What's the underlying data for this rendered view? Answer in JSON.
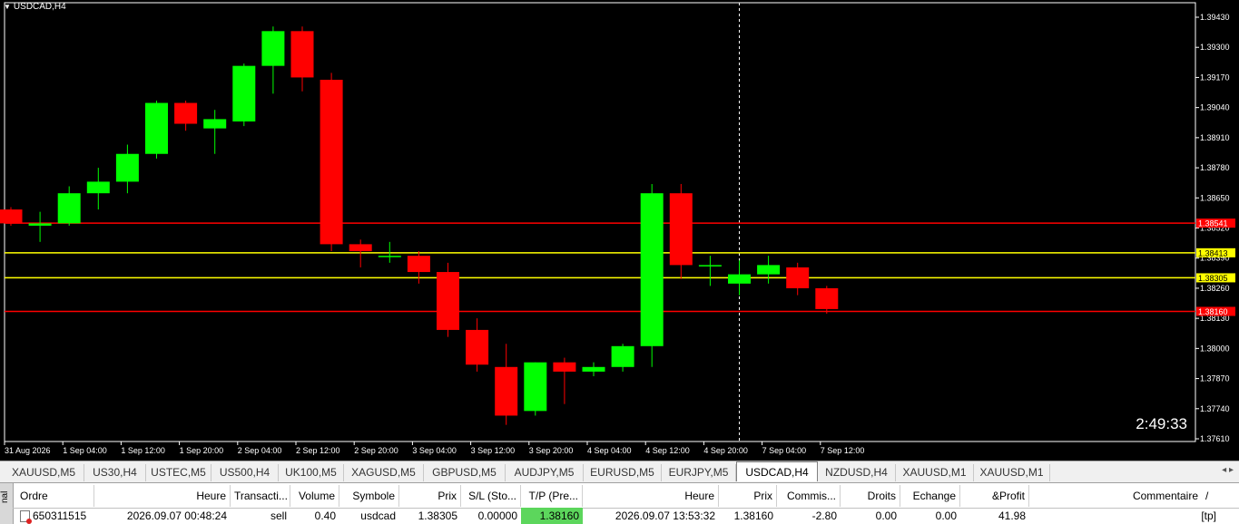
{
  "chart": {
    "symbol_label": "USDCAD,H4",
    "countdown": "2:49:33",
    "colors": {
      "bull": "#00ff00",
      "bear": "#ff0000",
      "background": "#000000",
      "axis": "#ffffff",
      "line_red": "#ff0000",
      "line_yellow": "#ffff00"
    },
    "y_range": [
      1.3761,
      1.3943
    ],
    "price_ticks": [
      "1.39430",
      "1.39300",
      "1.39170",
      "1.39040",
      "1.38910",
      "1.38780",
      "1.38650",
      "1.38520",
      "1.38390",
      "1.38260",
      "1.38130",
      "1.38000",
      "1.37870",
      "1.37740",
      "1.37610"
    ],
    "time_ticks": [
      "31 Aug 2026",
      "1 Sep 04:00",
      "1 Sep 12:00",
      "1 Sep 20:00",
      "2 Sep 04:00",
      "2 Sep 12:00",
      "2 Sep 20:00",
      "3 Sep 04:00",
      "3 Sep 12:00",
      "3 Sep 20:00",
      "4 Sep 04:00",
      "4 Sep 12:00",
      "4 Sep 20:00",
      "7 Sep 04:00",
      "7 Sep 12:00"
    ],
    "lines": [
      {
        "price": 1.38541,
        "label": "1.38541",
        "color": "#ff0000"
      },
      {
        "price": 1.38413,
        "label": "1.38413",
        "color": "#ffff00"
      },
      {
        "price": 1.38305,
        "label": "1.38305",
        "color": "#ffff00"
      },
      {
        "price": 1.3816,
        "label": "1.38160",
        "color": "#ff0000"
      }
    ],
    "crosshair_bar_index": 25,
    "candles": [
      {
        "o": 1.386,
        "h": 1.3861,
        "l": 1.3853,
        "c": 1.3854
      },
      {
        "o": 1.3853,
        "h": 1.3859,
        "l": 1.3846,
        "c": 1.3854
      },
      {
        "o": 1.3854,
        "h": 1.387,
        "l": 1.3853,
        "c": 1.3867
      },
      {
        "o": 1.3867,
        "h": 1.3878,
        "l": 1.386,
        "c": 1.3872
      },
      {
        "o": 1.3872,
        "h": 1.3888,
        "l": 1.3867,
        "c": 1.3884
      },
      {
        "o": 1.3884,
        "h": 1.3907,
        "l": 1.3882,
        "c": 1.3906
      },
      {
        "o": 1.3906,
        "h": 1.3907,
        "l": 1.3894,
        "c": 1.3897
      },
      {
        "o": 1.3895,
        "h": 1.3903,
        "l": 1.3884,
        "c": 1.3899
      },
      {
        "o": 1.3898,
        "h": 1.3923,
        "l": 1.3896,
        "c": 1.3922
      },
      {
        "o": 1.3922,
        "h": 1.3939,
        "l": 1.391,
        "c": 1.3937
      },
      {
        "o": 1.3937,
        "h": 1.3939,
        "l": 1.3911,
        "c": 1.3917
      },
      {
        "o": 1.3916,
        "h": 1.3919,
        "l": 1.3842,
        "c": 1.3845
      },
      {
        "o": 1.3845,
        "h": 1.3847,
        "l": 1.3835,
        "c": 1.3842
      },
      {
        "o": 1.384,
        "h": 1.3846,
        "l": 1.3837,
        "c": 1.384
      },
      {
        "o": 1.384,
        "h": 1.3842,
        "l": 1.3828,
        "c": 1.3833
      },
      {
        "o": 1.3833,
        "h": 1.3837,
        "l": 1.3805,
        "c": 1.3808
      },
      {
        "o": 1.3808,
        "h": 1.3813,
        "l": 1.379,
        "c": 1.3793
      },
      {
        "o": 1.3792,
        "h": 1.3802,
        "l": 1.3767,
        "c": 1.3771
      },
      {
        "o": 1.3773,
        "h": 1.3794,
        "l": 1.3771,
        "c": 1.3794
      },
      {
        "o": 1.3794,
        "h": 1.3796,
        "l": 1.3776,
        "c": 1.379
      },
      {
        "o": 1.379,
        "h": 1.3794,
        "l": 1.3788,
        "c": 1.3792
      },
      {
        "o": 1.3792,
        "h": 1.3802,
        "l": 1.379,
        "c": 1.3801
      },
      {
        "o": 1.3801,
        "h": 1.3871,
        "l": 1.3792,
        "c": 1.3867
      },
      {
        "o": 1.3867,
        "h": 1.3871,
        "l": 1.383,
        "c": 1.3836
      },
      {
        "o": 1.3836,
        "h": 1.384,
        "l": 1.3827,
        "c": 1.3836
      },
      {
        "o": 1.3828,
        "h": 1.3838,
        "l": 1.3823,
        "c": 1.3832
      },
      {
        "o": 1.3832,
        "h": 1.384,
        "l": 1.3828,
        "c": 1.3836
      },
      {
        "o": 1.3835,
        "h": 1.3837,
        "l": 1.3823,
        "c": 1.3826
      },
      {
        "o": 1.3826,
        "h": 1.3827,
        "l": 1.3815,
        "c": 1.3817
      }
    ]
  },
  "tabs": [
    "XAUUSD,M5",
    "US30,H4",
    "USTEC,M5",
    "US500,H4",
    "UK100,M5",
    "XAGUSD,M5",
    "GBPUSD,M5",
    "AUDJPY,M5",
    "EURUSD,M5",
    "EURJPY,M5",
    "USDCAD,H4",
    "NZDUSD,H4",
    "XAUUSD,M1",
    "XAUUSD,M1"
  ],
  "active_tab": "USDCAD,H4",
  "tab_arrows": "◂ ▸",
  "terminal": {
    "sidebar_label": "nal",
    "headers": {
      "ordre": "Ordre",
      "heure": "Heure",
      "transaction": "Transacti...",
      "volume": "Volume",
      "symbole": "Symbole",
      "prix": "Prix",
      "sl": "S/L (Sto...",
      "tp": "T/P (Pre...",
      "heure2": "Heure",
      "prix2": "Prix",
      "commission": "Commis...",
      "droits": "Droits",
      "echange": "Echange",
      "profit": "&Profit",
      "commentaire": "Commentaire",
      "sort": "/"
    },
    "row": {
      "ordre": "650311515",
      "heure": "2026.09.07 00:48:24",
      "transaction": "sell",
      "volume": "0.40",
      "symbole": "usdcad",
      "prix": "1.38305",
      "sl": "0.00000",
      "tp": "1.38160",
      "heure2": "2026.09.07 13:53:32",
      "prix2": "1.38160",
      "commission": "-2.80",
      "droits": "0.00",
      "echange": "0.00",
      "profit": "41.98",
      "commentaire": "[tp]"
    }
  }
}
